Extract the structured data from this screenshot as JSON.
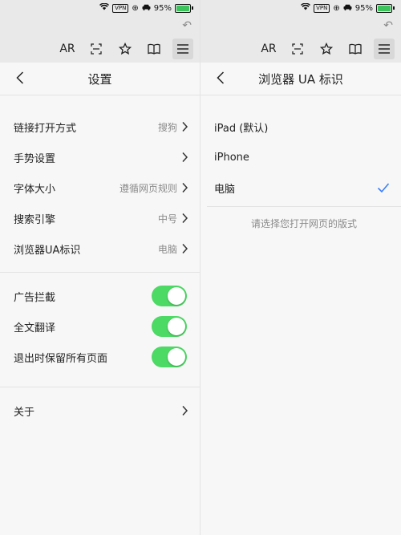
{
  "status": {
    "battery": "95%",
    "vpn": "VPN",
    "battery_fraction": 0.95
  },
  "toolbar": {
    "ar_label": "AR"
  },
  "left": {
    "title": "设置",
    "group1": [
      {
        "label": "链接打开方式",
        "value": "搜狗"
      },
      {
        "label": "手势设置",
        "value": ""
      },
      {
        "label": "字体大小",
        "value": "遵循网页规则"
      },
      {
        "label": "搜索引擎",
        "value": "中号"
      },
      {
        "label": "浏览器UA标识",
        "value": "电脑"
      }
    ],
    "toggles": [
      {
        "label": "广告拦截",
        "on": true
      },
      {
        "label": "全文翻译",
        "on": true
      },
      {
        "label": "退出时保留所有页面",
        "on": true
      }
    ],
    "about": {
      "label": "关于"
    }
  },
  "right": {
    "title": "浏览器 UA 标识",
    "options": [
      {
        "label": "iPad (默认)",
        "selected": false
      },
      {
        "label": "iPhone",
        "selected": false
      },
      {
        "label": "电脑",
        "selected": true
      }
    ],
    "hint": "请选择您打开网页的版式"
  },
  "colors": {
    "toggle_on": "#4cd964",
    "check": "#3b7ff5"
  }
}
